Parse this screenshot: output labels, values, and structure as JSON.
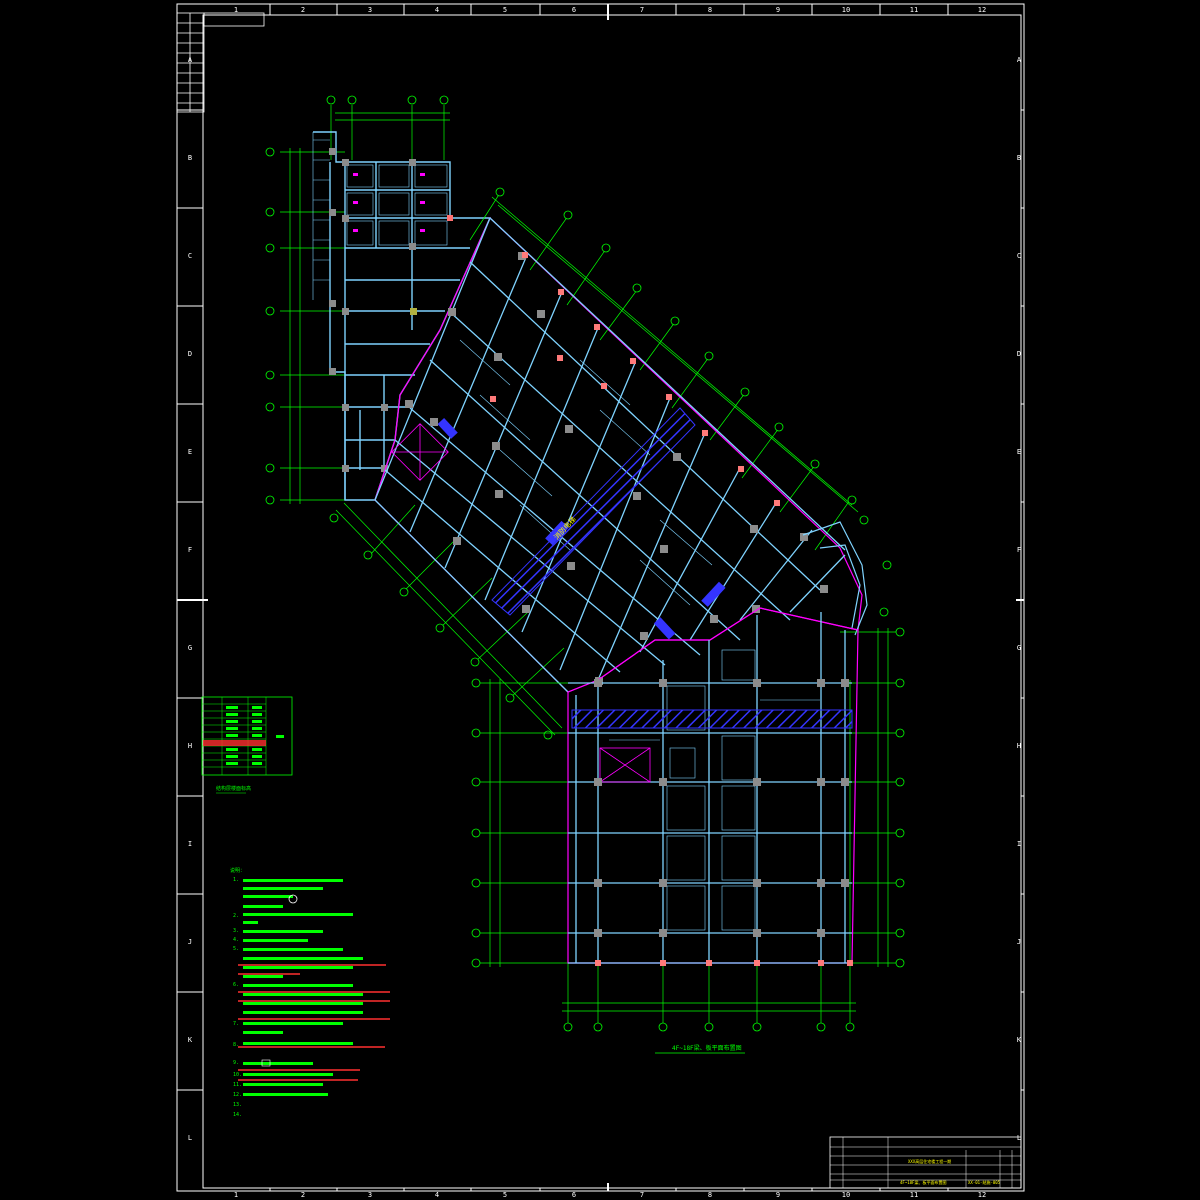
{
  "sheet": {
    "top_columns": [
      "1",
      "2",
      "3",
      "4",
      "5",
      "6",
      "7",
      "8",
      "9",
      "10",
      "11",
      "12"
    ],
    "bottom_columns": [
      "1",
      "2",
      "3",
      "4",
      "5",
      "6",
      "7",
      "8",
      "9",
      "10",
      "11",
      "12"
    ],
    "side_rows": [
      "A",
      "B",
      "C",
      "D",
      "E",
      "F",
      "G",
      "H",
      "I",
      "J",
      "K",
      "L"
    ]
  },
  "title_block": {
    "project": "XXX高层住宅楼工程一期",
    "drawing_name": "4F~18F梁、板平面布置图",
    "drawing_number": "XX-01-结施-005"
  },
  "plan_caption": "4F~18F梁、板平面布置图",
  "level_table_caption": "结构层楼面标高",
  "level_table_note": "结构层高",
  "notes_heading": "说明：",
  "note_numbers": [
    "1.",
    "2.",
    "3.",
    "4.",
    "5.",
    "6.",
    "7.",
    "8.",
    "9.",
    "10.",
    "11.",
    "12.",
    "13.",
    "14."
  ],
  "ramp_label": "消防电梯",
  "colors": {
    "background": "#000000",
    "frame": "#ffffff",
    "axis": "#00ff00",
    "beam": "#7fd3ff",
    "column": "#8c8c8c",
    "slab_opening": "#3434ff",
    "boundary": "#ff00ff",
    "highlight": "#ff3030",
    "text_note": "#00ff00",
    "dim_line": "#00ff00"
  }
}
